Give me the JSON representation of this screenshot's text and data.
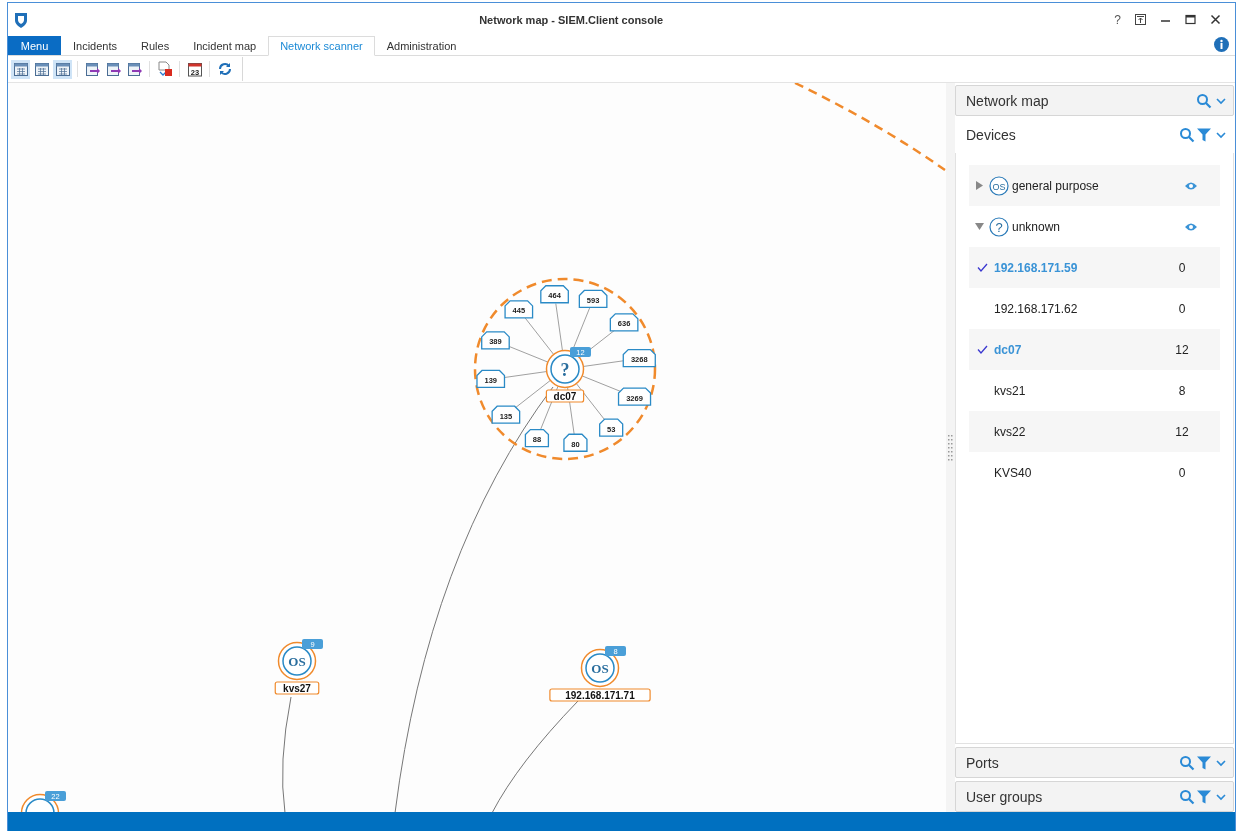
{
  "window": {
    "title": "Network map - SIEM.Client console",
    "help_symbol": "?"
  },
  "menu_button": {
    "label": "Menu"
  },
  "tabs": [
    {
      "label": "Incidents",
      "selected": false
    },
    {
      "label": "Rules",
      "selected": false
    },
    {
      "label": "Incident map",
      "selected": false
    },
    {
      "label": "Network scanner",
      "selected": true
    },
    {
      "label": "Administration",
      "selected": false
    }
  ],
  "toolbar": [
    {
      "kind": "grid",
      "selected": true
    },
    {
      "kind": "grid",
      "selected": false
    },
    {
      "kind": "grid",
      "selected": true
    },
    {
      "kind": "separator"
    },
    {
      "kind": "export"
    },
    {
      "kind": "export"
    },
    {
      "kind": "export"
    },
    {
      "kind": "separator"
    },
    {
      "kind": "pdf"
    },
    {
      "kind": "separator"
    },
    {
      "kind": "calendar",
      "text": "23"
    },
    {
      "kind": "separator"
    },
    {
      "kind": "refresh"
    }
  ],
  "map": {
    "nodes": [
      {
        "kind": "unknown",
        "symbol": "?",
        "name": "dc07",
        "count": "12",
        "highlighted": true,
        "ports": [
          "445",
          "464",
          "593",
          "636",
          "3268",
          "3269",
          "53",
          "80",
          "88",
          "135",
          "139",
          "389"
        ]
      },
      {
        "kind": "os",
        "symbol": "OS",
        "name": "kvs27",
        "count": "9",
        "highlighted": false
      },
      {
        "kind": "os",
        "symbol": "OS",
        "name": "192.168.171.71",
        "count": "8",
        "highlighted": false
      },
      {
        "kind": "os",
        "count": "22",
        "highlighted": false
      }
    ]
  },
  "sidebar": {
    "sections": [
      {
        "title": "Network map",
        "expanded": false,
        "filter": false
      },
      {
        "title": "Devices",
        "expanded": true,
        "filter": true,
        "groups": [
          {
            "symbol": "OS",
            "label": "general purpose",
            "expanded": false,
            "visible": true
          },
          {
            "symbol": "?",
            "label": "unknown",
            "expanded": true,
            "visible": true,
            "children": [
              {
                "name": "192.168.171.59",
                "count": "0",
                "checked": true
              },
              {
                "name": "192.168.171.62",
                "count": "0",
                "checked": false
              },
              {
                "name": "dc07",
                "count": "12",
                "checked": true
              },
              {
                "name": "kvs21",
                "count": "8",
                "checked": false
              },
              {
                "name": "kvs22",
                "count": "12",
                "checked": false
              },
              {
                "name": "KVS40",
                "count": "0",
                "checked": false
              }
            ]
          }
        ]
      },
      {
        "title": "Ports",
        "expanded": false,
        "filter": true
      },
      {
        "title": "User groups",
        "expanded": false,
        "filter": true
      }
    ]
  }
}
